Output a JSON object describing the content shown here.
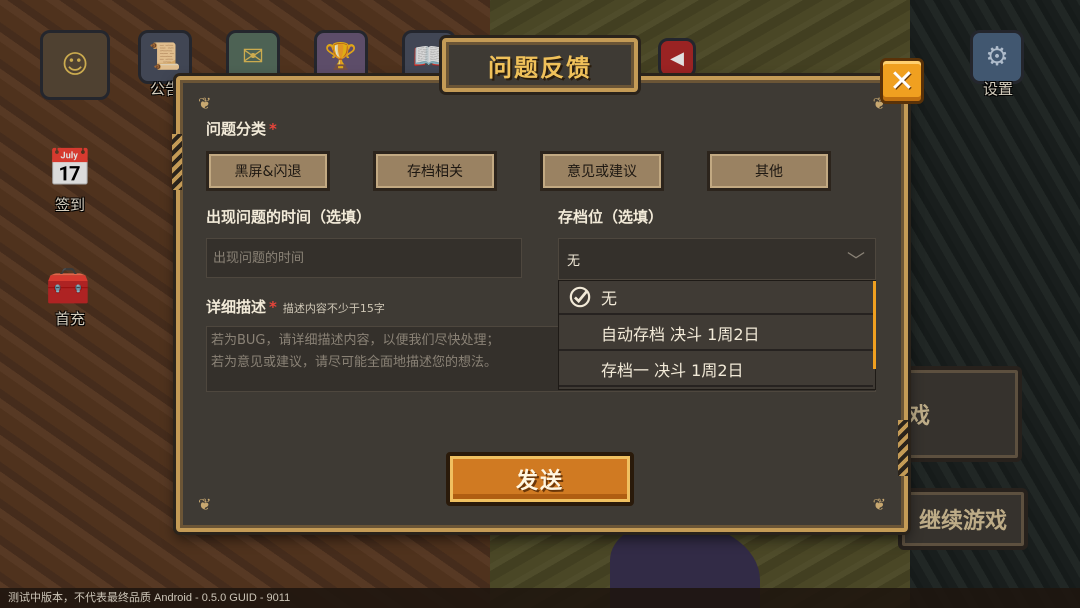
{
  "hud": {
    "announcement_label": "公告",
    "settings_label": "设置",
    "checkin_label": "签到",
    "first_recharge_label": "首充",
    "continue_game_label": "继续游戏",
    "partial_button_label": "戏"
  },
  "status_bar": "测试中版本，不代表最终品质   Android - 0.5.0   GUID - 9011",
  "dialog": {
    "title": "问题反馈",
    "close_symbol": "✕",
    "category": {
      "label": "问题分类",
      "required_mark": "*",
      "options": [
        "黑屏&闪退",
        "存档相关",
        "意见或建议",
        "其他"
      ]
    },
    "time": {
      "label": "出现问题的时间（选填）",
      "placeholder": "出现问题的时间",
      "value": ""
    },
    "save_slot": {
      "label": "存档位（选填）",
      "selected": "无",
      "options": [
        "无",
        "自动存档 决斗 1周2日",
        "存档一 决斗 1周2日"
      ]
    },
    "description": {
      "label": "详细描述",
      "required_mark": "*",
      "hint": "描述内容不少于15字",
      "placeholder_line1": "若为BUG，请详细描述内容，以便我们尽快处理；",
      "placeholder_line2": "若为意见或建议，请尽可能全面地描述您的想法。"
    },
    "send_label": "发送"
  },
  "colors": {
    "frame_gold": "#c49b56",
    "panel": "#3e3a34",
    "title_text": "#f0c15a",
    "close_orange": "#f0a020",
    "send_orange": "#d07a22",
    "required_red": "#e8443a"
  },
  "icons": {
    "checked_option": "check-circle-icon",
    "dropdown_arrow": "chevron-down-icon",
    "close": "close-icon",
    "settings": "gear-icon"
  }
}
